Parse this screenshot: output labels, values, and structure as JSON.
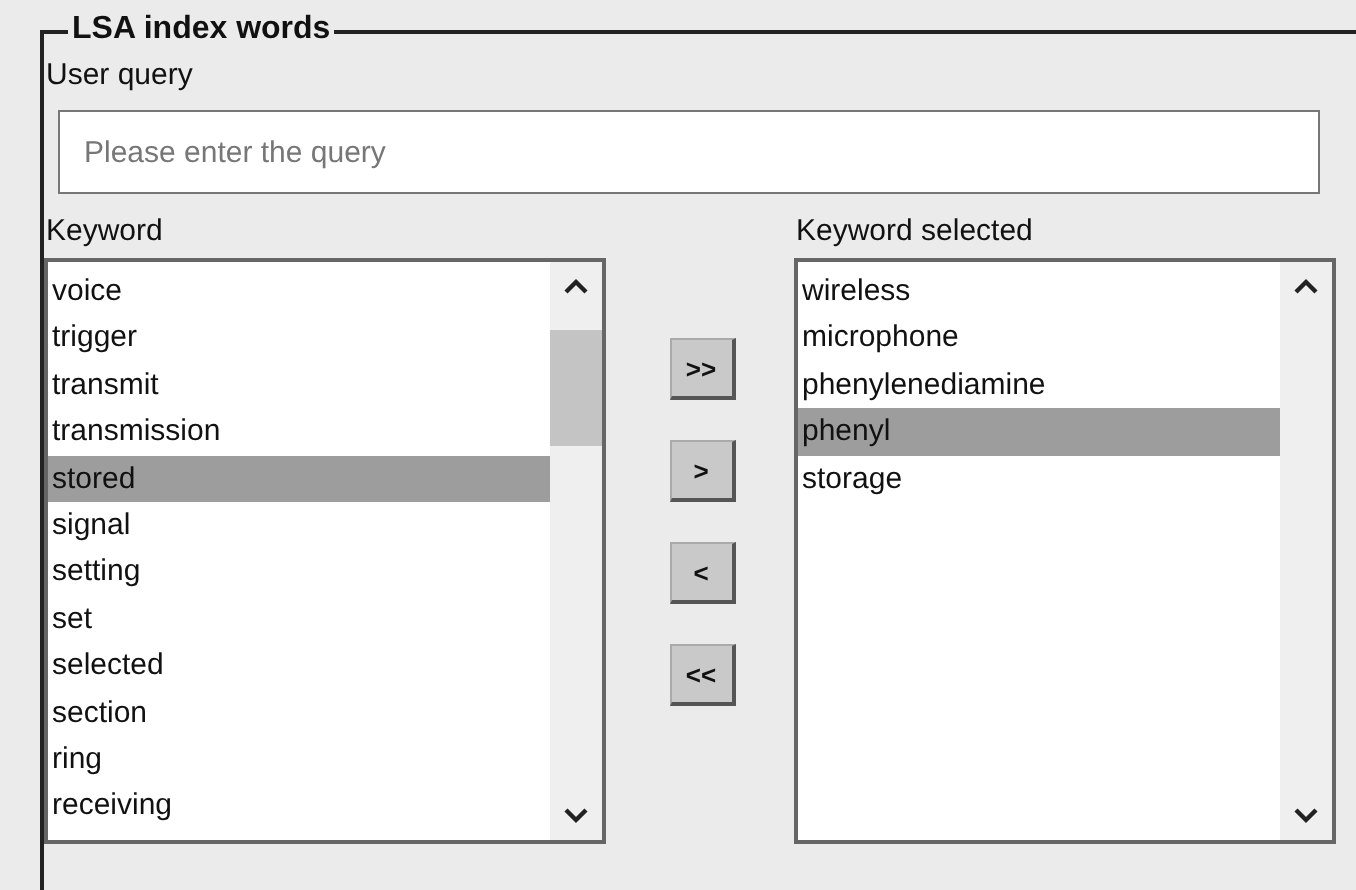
{
  "group": {
    "title": "LSA index words"
  },
  "query": {
    "label": "User query",
    "placeholder": "Please enter the query"
  },
  "keyword_list": {
    "label": "Keyword",
    "items": [
      {
        "text": "voice",
        "selected": false
      },
      {
        "text": "trigger",
        "selected": false
      },
      {
        "text": "transmit",
        "selected": false
      },
      {
        "text": "transmission",
        "selected": false
      },
      {
        "text": "stored",
        "selected": true
      },
      {
        "text": "signal",
        "selected": false
      },
      {
        "text": "setting",
        "selected": false
      },
      {
        "text": "set",
        "selected": false
      },
      {
        "text": "selected",
        "selected": false
      },
      {
        "text": "section",
        "selected": false
      },
      {
        "text": "ring",
        "selected": false
      },
      {
        "text": "receiving",
        "selected": false
      }
    ]
  },
  "move_buttons": [
    ">>",
    ">",
    "<",
    "<<"
  ],
  "selected_list": {
    "label": "Keyword selected",
    "items": [
      {
        "text": "wireless",
        "selected": false
      },
      {
        "text": "microphone",
        "selected": false
      },
      {
        "text": "phenylenediamine",
        "selected": false
      },
      {
        "text": "phenyl",
        "selected": true
      },
      {
        "text": "storage",
        "selected": false
      }
    ]
  }
}
